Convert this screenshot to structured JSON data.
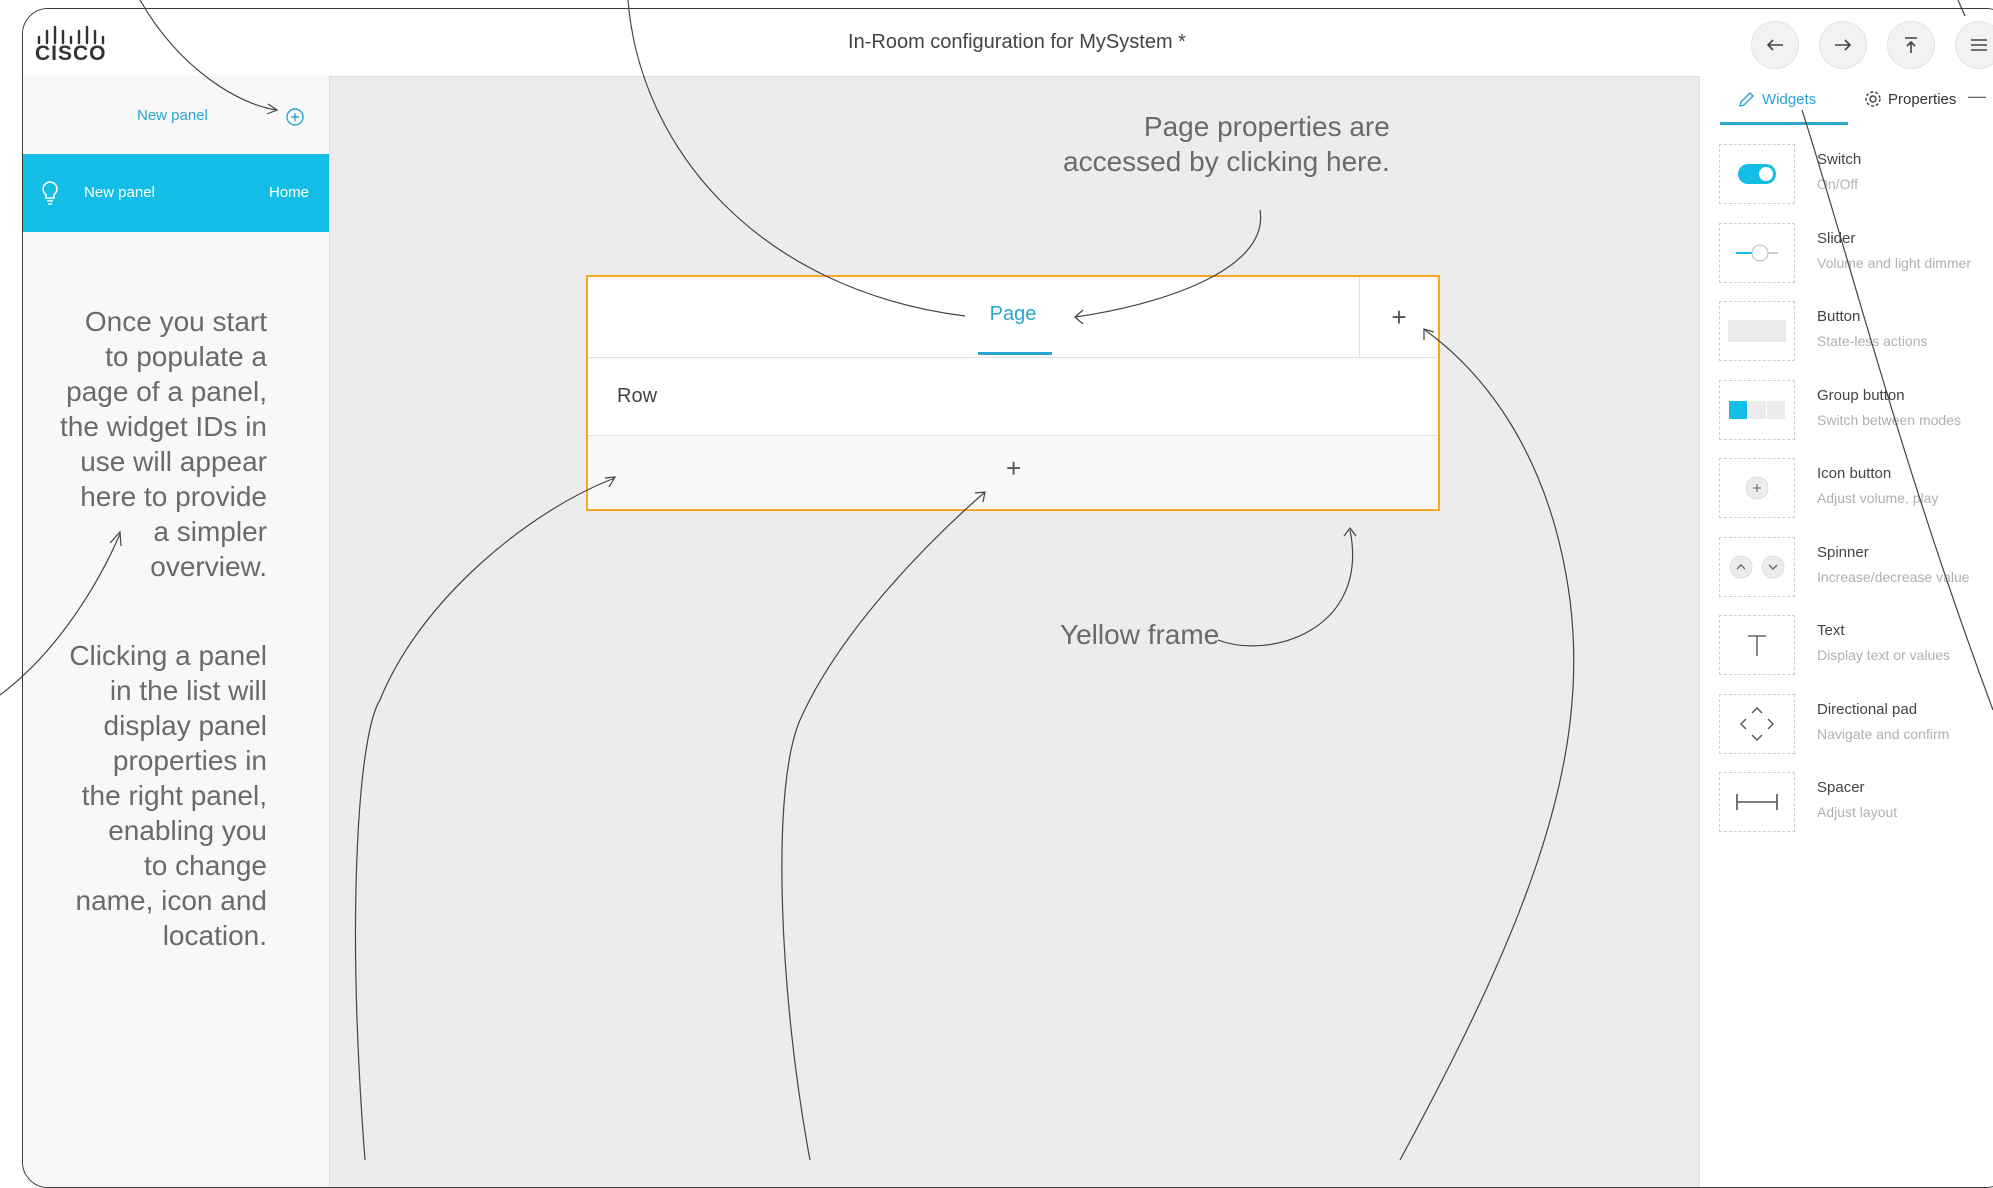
{
  "header": {
    "logo_text": "CISCO",
    "title": "In-Room configuration for MySystem *"
  },
  "left_panel": {
    "new_panel_link": "New panel",
    "panel_item": {
      "name": "New panel",
      "location": "Home"
    },
    "note_1": [
      "Once you start",
      "to populate a",
      "page of a panel,",
      "the widget IDs in",
      "use will appear",
      "here to provide",
      "a simpler",
      "overview."
    ],
    "note_2": [
      "Clicking a panel",
      "in the list will",
      "display panel",
      "properties in",
      "the right panel,",
      "enabling you",
      "to change",
      "name, icon and",
      "location."
    ]
  },
  "right_panel": {
    "tabs": {
      "widgets": "Widgets",
      "properties": "Properties"
    },
    "widgets": [
      {
        "name": "Switch",
        "desc": "On/Off",
        "icon": "toggle-icon"
      },
      {
        "name": "Slider",
        "desc": "Volume and light dimmer",
        "icon": "slider-icon"
      },
      {
        "name": "Button",
        "desc": "State-less actions",
        "icon": "button-icon"
      },
      {
        "name": "Group button",
        "desc": "Switch between modes",
        "icon": "group-button-icon"
      },
      {
        "name": "Icon button",
        "desc": "Adjust volume, play",
        "icon": "plus-circle-icon"
      },
      {
        "name": "Spinner",
        "desc": "Increase/decrease value",
        "icon": "spinner-icon"
      },
      {
        "name": "Text",
        "desc": "Display text or values",
        "icon": "text-icon"
      },
      {
        "name": "Directional pad",
        "desc": "Navigate and confirm",
        "icon": "dpad-icon"
      },
      {
        "name": "Spacer",
        "desc": "Adjust layout",
        "icon": "spacer-icon"
      }
    ]
  },
  "editor": {
    "page_tab": "Page",
    "row_label": "Row",
    "add_symbol": "+"
  },
  "callouts": {
    "page_properties": [
      "Page properties are",
      "accessed by clicking here."
    ],
    "yellow_frame": "Yellow frame"
  },
  "colors": {
    "accent": "#2aa7d0",
    "selected_panel": "#13bde6",
    "frame": "#f5a623"
  }
}
